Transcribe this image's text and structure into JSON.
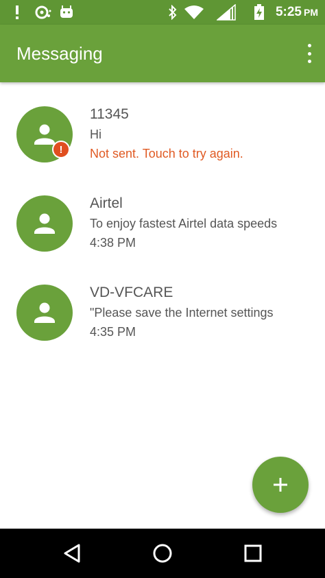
{
  "status_bar": {
    "time": "5:25",
    "ampm": "PM",
    "icons": [
      "notification-alert-icon",
      "sync-icon",
      "android-icon",
      "bluetooth-icon",
      "wifi-icon",
      "cell-signal-icon",
      "battery-charging-icon"
    ]
  },
  "app_bar": {
    "title": "Messaging",
    "menu_icon": "more-vert-icon"
  },
  "conversations": [
    {
      "name": "11345",
      "snippet": "Hi",
      "meta": "Not sent. Touch to try again.",
      "status": "error"
    },
    {
      "name": "Airtel",
      "snippet": "To enjoy fastest Airtel data speeds",
      "meta": "4:38 PM",
      "status": "ok"
    },
    {
      "name": "VD-VFCARE",
      "snippet": "\"Please save the Internet settings",
      "meta": "4:35 PM",
      "status": "ok"
    }
  ],
  "fab": {
    "icon": "add-icon"
  },
  "nav_bar": {
    "icons": [
      "back-icon",
      "home-icon",
      "recents-icon"
    ]
  },
  "colors": {
    "status_bar": "#5f9634",
    "primary": "#6aa13b",
    "error": "#e05a23",
    "text": "#555555"
  }
}
